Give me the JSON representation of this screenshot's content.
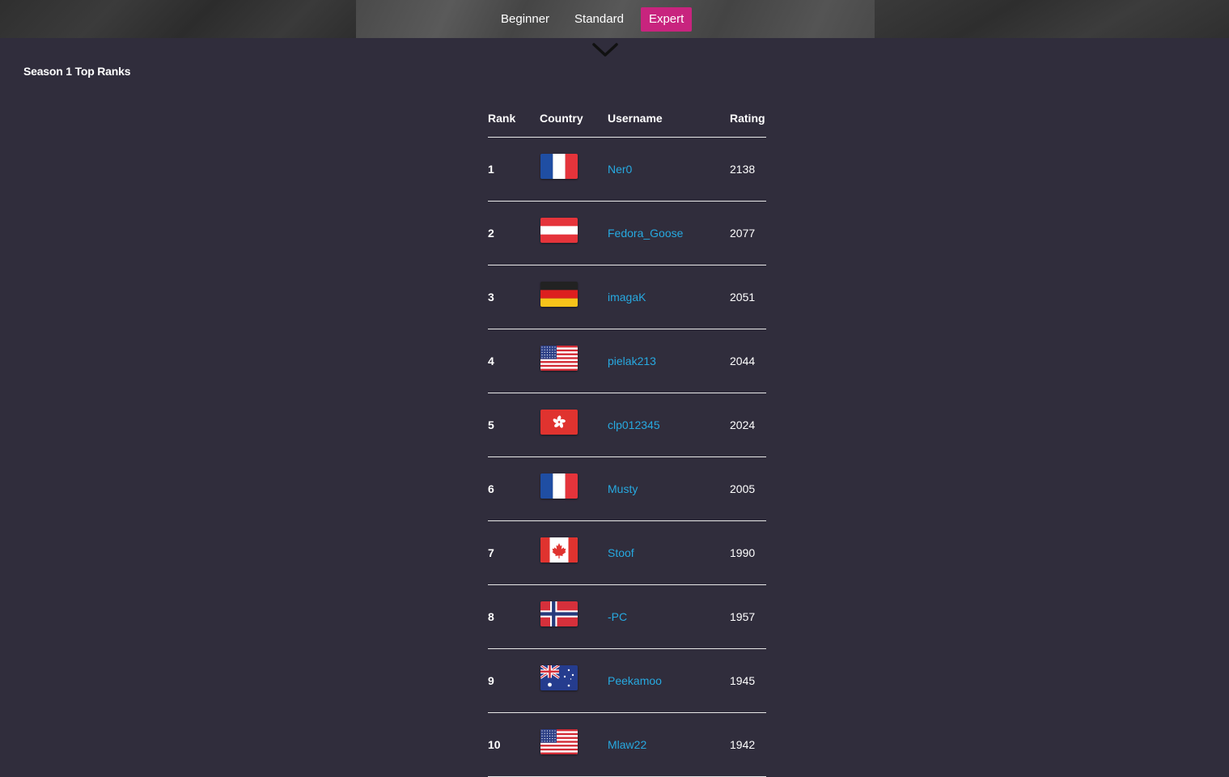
{
  "tabs": [
    {
      "label": "Beginner",
      "active": false
    },
    {
      "label": "Standard",
      "active": false
    },
    {
      "label": "Expert",
      "active": true
    }
  ],
  "season_title": "Season 1 Top Ranks",
  "table": {
    "headers": {
      "rank": "Rank",
      "country": "Country",
      "username": "Username",
      "rating": "Rating"
    },
    "rows": [
      {
        "rank": "1",
        "country": "france-flag",
        "username": "Ner0",
        "rating": "2138"
      },
      {
        "rank": "2",
        "country": "austria-flag",
        "username": "Fedora_Goose",
        "rating": "2077"
      },
      {
        "rank": "3",
        "country": "germany-flag",
        "username": "imagaK",
        "rating": "2051"
      },
      {
        "rank": "4",
        "country": "usa-flag",
        "username": "pielak213",
        "rating": "2044"
      },
      {
        "rank": "5",
        "country": "hong-kong-flag",
        "username": "clp012345",
        "rating": "2024"
      },
      {
        "rank": "6",
        "country": "france-flag",
        "username": "Musty",
        "rating": "2005"
      },
      {
        "rank": "7",
        "country": "canada-flag",
        "username": "Stoof",
        "rating": "1990"
      },
      {
        "rank": "8",
        "country": "norway-flag",
        "username": "-PC",
        "rating": "1957"
      },
      {
        "rank": "9",
        "country": "australia-flag",
        "username": "Peekamoo",
        "rating": "1945"
      },
      {
        "rank": "10",
        "country": "usa-flag",
        "username": "Mlaw22",
        "rating": "1942"
      }
    ]
  },
  "colors": {
    "background": "#302d3c",
    "active_tab": "#c8247e",
    "link": "#27a9e0"
  }
}
